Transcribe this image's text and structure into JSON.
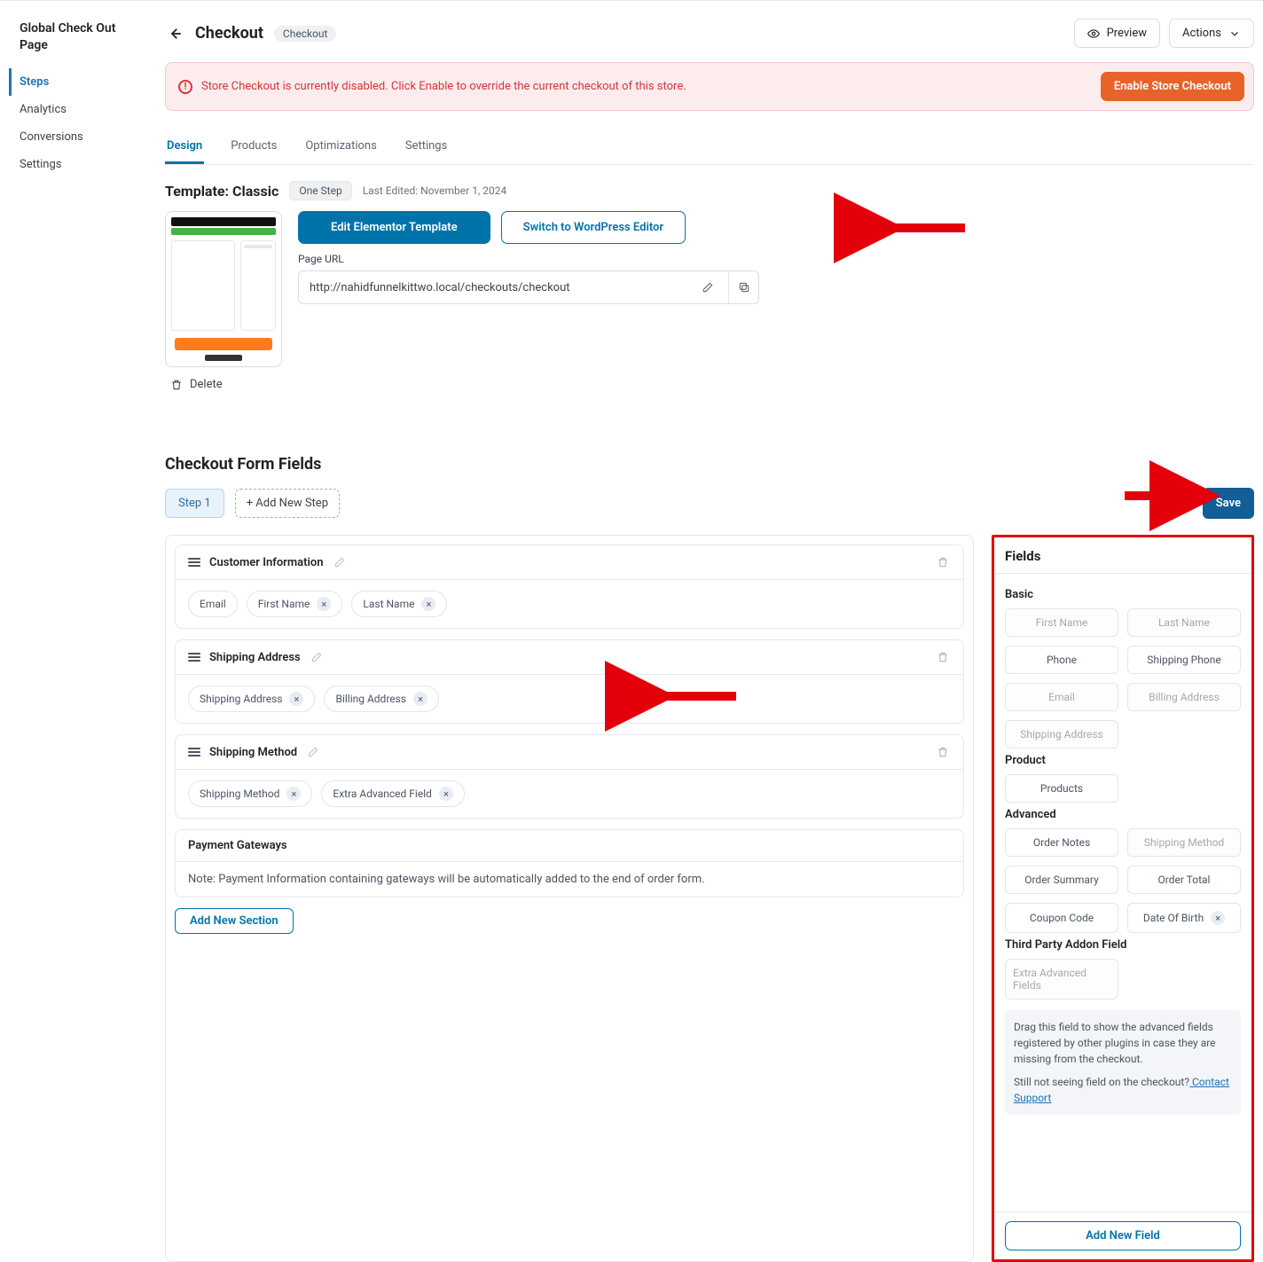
{
  "sidebar": {
    "title": "Global Check Out Page",
    "items": [
      {
        "label": "Steps",
        "active": true
      },
      {
        "label": "Analytics"
      },
      {
        "label": "Conversions"
      },
      {
        "label": "Settings"
      }
    ]
  },
  "header": {
    "title": "Checkout",
    "badge": "Checkout",
    "preview": "Preview",
    "actions": "Actions"
  },
  "notice": {
    "text": "Store Checkout is currently disabled. Click Enable to override the current checkout of this store.",
    "button": "Enable Store Checkout"
  },
  "tabs": [
    {
      "label": "Design",
      "active": true
    },
    {
      "label": "Products"
    },
    {
      "label": "Optimizations"
    },
    {
      "label": "Settings"
    }
  ],
  "template": {
    "title": "Template: Classic",
    "pill": "One Step",
    "last_edited": "Last Edited: November 1, 2024",
    "edit_btn": "Edit Elementor Template",
    "switch_btn": "Switch to WordPress Editor",
    "url_label": "Page URL",
    "url": "http://nahidfunnelkittwo.local/checkouts/checkout",
    "delete": "Delete"
  },
  "cff": {
    "heading": "Checkout Form Fields",
    "step": "Step 1",
    "add_step": "+ Add New Step",
    "save": "Save",
    "add_section": "Add New Section",
    "cards": [
      {
        "title": "Customer Information",
        "chips": [
          {
            "t": "Email"
          },
          {
            "t": "First Name",
            "x": true
          },
          {
            "t": "Last Name",
            "x": true
          }
        ]
      },
      {
        "title": "Shipping Address",
        "chips": [
          {
            "t": "Shipping Address",
            "x": true
          },
          {
            "t": "Billing Address",
            "x": true
          }
        ]
      },
      {
        "title": "Shipping Method",
        "chips": [
          {
            "t": "Shipping Method",
            "x": true
          },
          {
            "t": "Extra Advanced Field",
            "x": true
          }
        ]
      }
    ],
    "payment": {
      "title": "Payment Gateways",
      "note": "Note: Payment Information containing gateways will be automatically added to the end of order form."
    }
  },
  "fields": {
    "title": "Fields",
    "groups": [
      {
        "name": "Basic",
        "items": [
          {
            "t": "First Name",
            "dis": true
          },
          {
            "t": "Last Name",
            "dis": true
          },
          {
            "t": "Phone"
          },
          {
            "t": "Shipping Phone"
          },
          {
            "t": "Email",
            "dis": true
          },
          {
            "t": "Billing Address",
            "dis": true
          },
          {
            "t": "Shipping Address",
            "dis": true
          }
        ]
      },
      {
        "name": "Product",
        "items": [
          {
            "t": "Products"
          }
        ]
      },
      {
        "name": "Advanced",
        "items": [
          {
            "t": "Order Notes"
          },
          {
            "t": "Shipping Method",
            "dis": true
          },
          {
            "t": "Order Summary"
          },
          {
            "t": "Order Total"
          },
          {
            "t": "Coupon Code"
          },
          {
            "t": "Date Of Birth",
            "x": true
          }
        ]
      },
      {
        "name": "Third Party Addon Field",
        "items": [
          {
            "t": "Extra Advanced Fields",
            "dis": true
          }
        ]
      }
    ],
    "hint1": "Drag this field to show the advanced fields registered by other plugins in case they are missing from the checkout.",
    "hint2": "Still not seeing field on the checkout?",
    "hint_link": " Contact Support",
    "add_new": "Add New Field"
  }
}
